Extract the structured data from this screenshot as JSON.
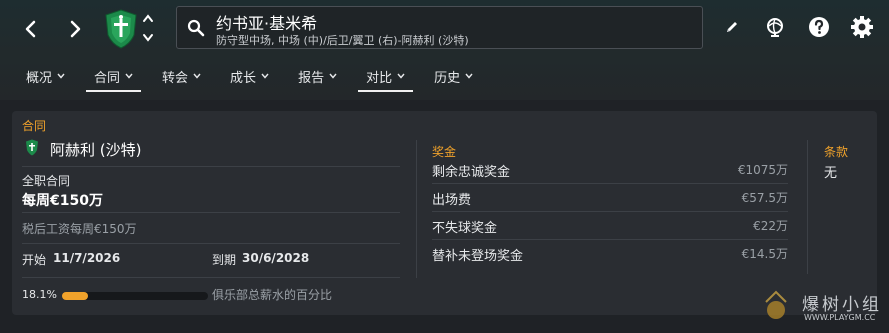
{
  "header": {
    "player_name": "约书亚·基米希",
    "player_positions": "防守型中场, 中场 (中)/后卫/翼卫 (右)-阿赫利 (沙特)"
  },
  "icons": {
    "back": "chevron-left-icon",
    "forward": "chevron-right-icon",
    "club_crest": "club-crest-icon",
    "stepper": "up-down-stepper-icon",
    "search": "search-icon",
    "edit": "pencil-icon",
    "world": "globe-icon",
    "help": "question-icon",
    "settings": "gear-icon"
  },
  "tabs": [
    {
      "label": "概况",
      "active": false
    },
    {
      "label": "合同",
      "active": true
    },
    {
      "label": "转会",
      "active": false
    },
    {
      "label": "成长",
      "active": false
    },
    {
      "label": "报告",
      "active": false
    },
    {
      "label": "对比",
      "active": true
    },
    {
      "label": "历史",
      "active": false
    }
  ],
  "contract": {
    "section_title": "合同",
    "club": "阿赫利 (沙特)",
    "type": "全职合同",
    "weekly_wage": "每周€150万",
    "after_tax": "税后工资每周€150万",
    "start_label": "开始",
    "start_date": "11/7/2026",
    "expiry_label": "到期",
    "expiry_date": "30/6/2028",
    "wage_share_percent": "18.1%",
    "wage_share_value": 0.181,
    "wage_share_label": "俱乐部总薪水的百分比"
  },
  "bonuses": {
    "section_title": "奖金",
    "items": [
      {
        "name": "剩余忠诚奖金",
        "amount": "€1075万"
      },
      {
        "name": "出场费",
        "amount": "€57.5万"
      },
      {
        "name": "不失球奖金",
        "amount": "€22万"
      },
      {
        "name": "替补未登场奖金",
        "amount": "€14.5万"
      }
    ]
  },
  "clauses": {
    "section_title": "条款",
    "value": "无"
  },
  "watermark": {
    "text": "爆树小组",
    "url": "WWW.PLAYGM.CC"
  },
  "colors": {
    "accent": "#f0a22b",
    "club_green": "#1c8a4a",
    "panel": "#2a2d32"
  }
}
